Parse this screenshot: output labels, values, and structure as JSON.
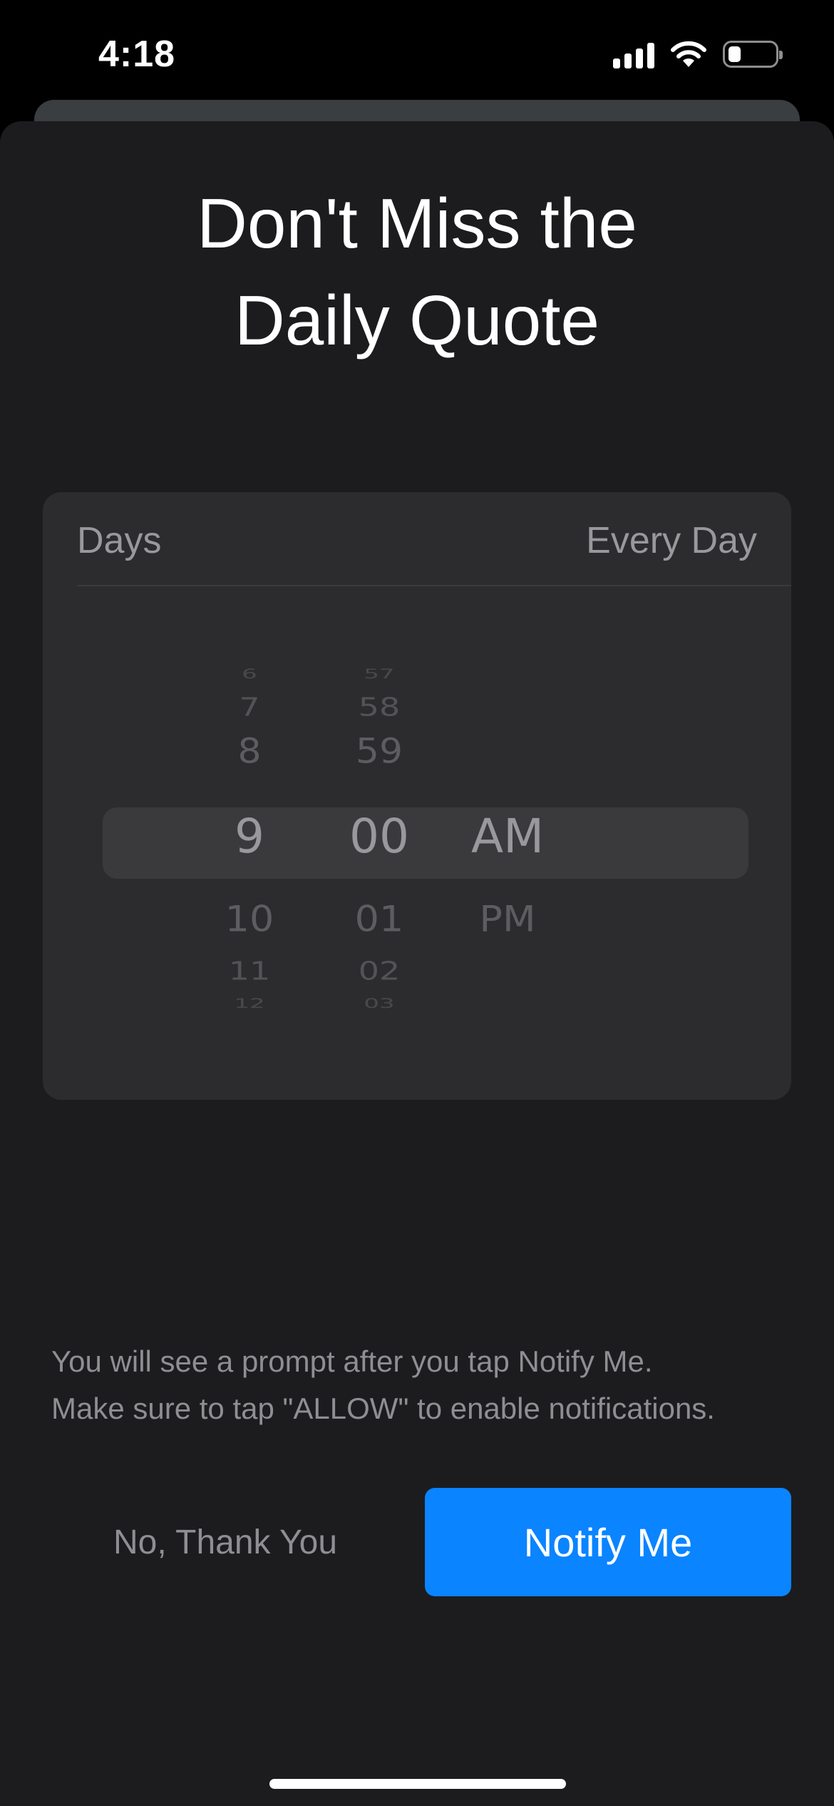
{
  "status_bar": {
    "time": "4:18",
    "icons": [
      "cellular-signal-icon",
      "wifi-icon",
      "battery-icon"
    ],
    "battery_level": 0.25
  },
  "sheet": {
    "title_line1": "Don't Miss the",
    "title_line2": "Daily Quote"
  },
  "schedule": {
    "days_label": "Days",
    "days_value": "Every Day"
  },
  "time_picker": {
    "hours": [
      "6",
      "7",
      "8",
      "9",
      "10",
      "11",
      "12"
    ],
    "minutes": [
      "57",
      "58",
      "59",
      "00",
      "01",
      "02",
      "03"
    ],
    "periods": [
      "AM",
      "PM"
    ],
    "selected_hour": "9",
    "selected_minute": "00",
    "selected_period": "AM"
  },
  "note": {
    "line1": "You will see a prompt after you tap Notify Me.",
    "line2": "Make sure to tap \"ALLOW\" to enable notifications."
  },
  "actions": {
    "decline_label": "No, Thank You",
    "confirm_label": "Notify Me"
  },
  "colors": {
    "accent": "#0a84ff",
    "sheet_background": "#1c1c1e",
    "card_background": "#2c2c2e"
  }
}
